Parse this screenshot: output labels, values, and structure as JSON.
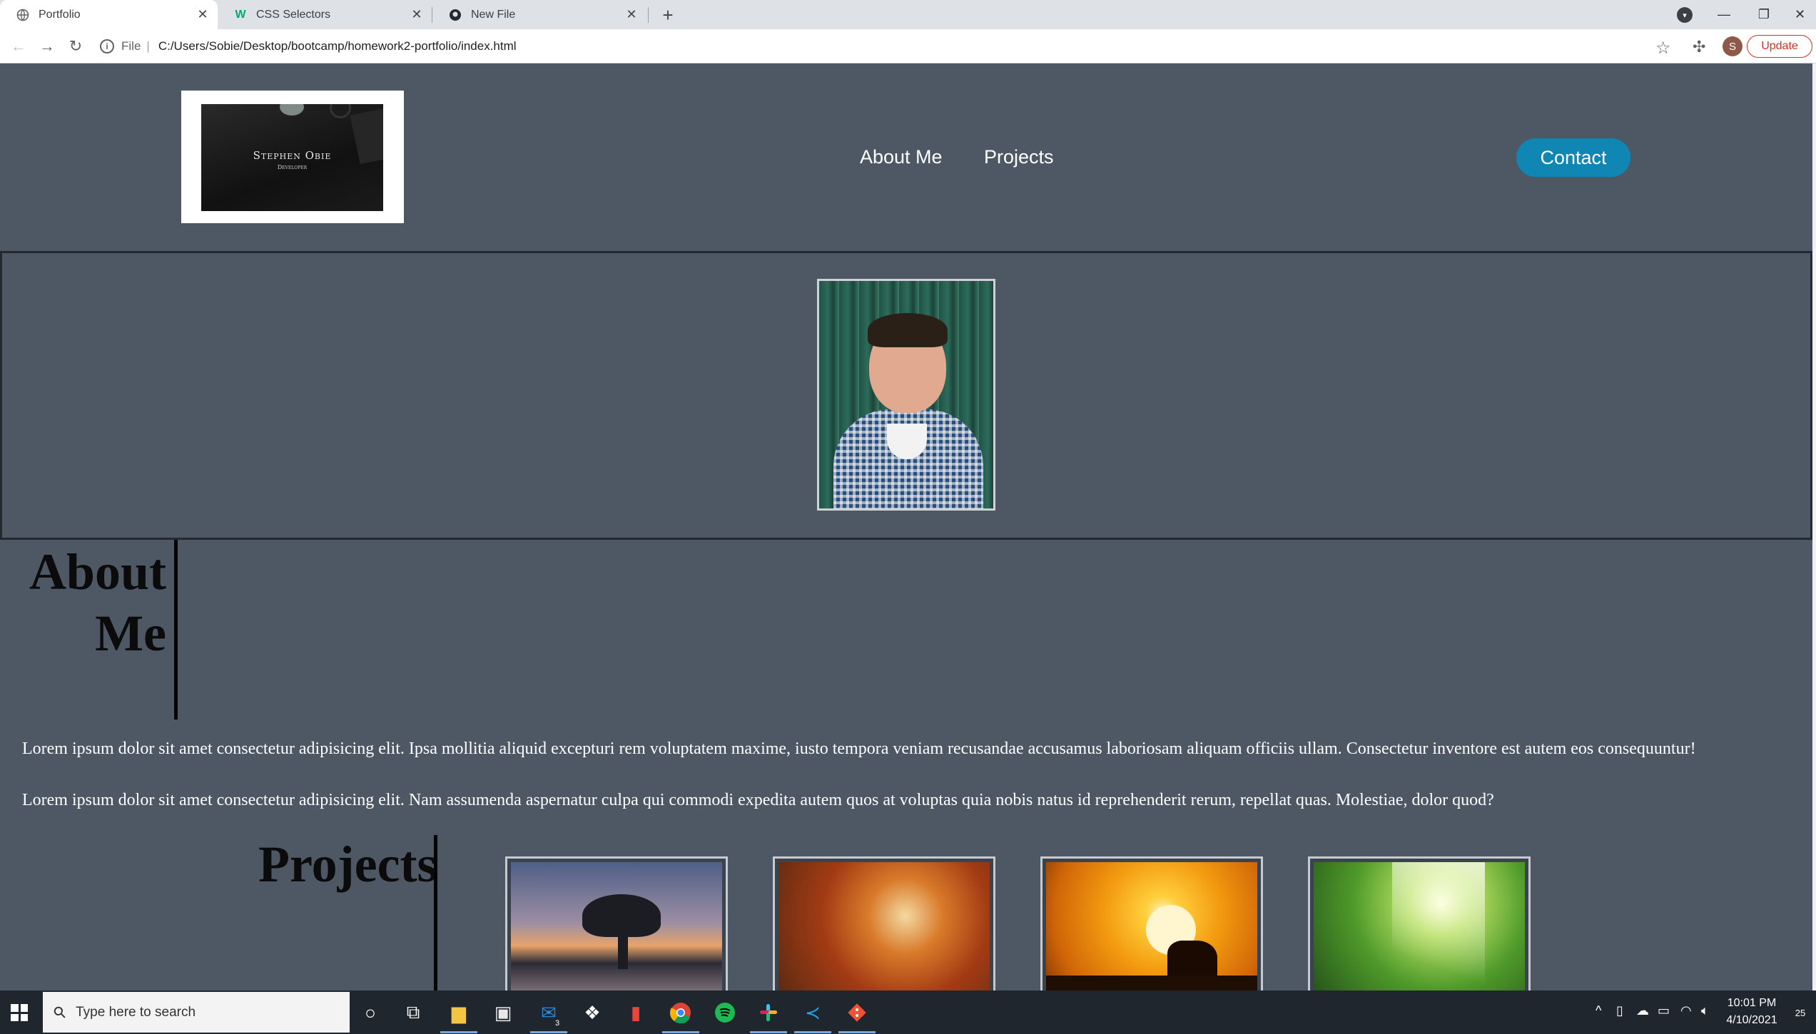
{
  "browser": {
    "tabs": [
      {
        "title": "Portfolio",
        "icon": "globe-icon"
      },
      {
        "title": "CSS Selectors",
        "icon": "w3schools-icon"
      },
      {
        "title": "New File",
        "icon": "github-icon"
      }
    ],
    "address": {
      "scheme": "File",
      "url": "C:/Users/Sobie/Desktop/bootcamp/homework2-portfolio/index.html"
    },
    "profile_initial": "S",
    "update_label": "Update"
  },
  "page": {
    "logo": {
      "name": "Stephen Obie",
      "role": "Developer"
    },
    "nav": [
      {
        "label": "About Me"
      },
      {
        "label": "Projects"
      }
    ],
    "contact_label": "Contact",
    "about": {
      "heading": "About Me",
      "paragraphs": [
        "Lorem ipsum dolor sit amet consectetur adipisicing elit. Ipsa mollitia aliquid excepturi rem voluptatem maxime, iusto tempora veniam recusandae accusamus laboriosam aliquam officiis ullam. Consectetur inventore est autem eos consequuntur!",
        "Lorem ipsum dolor sit amet consectetur adipisicing elit. Nam assumenda aspernatur culpa qui commodi expedita autem quos at voluptas quia nobis natus id reprehenderit rerum, repellat quas. Molestiae, dolor quod?"
      ]
    },
    "projects": {
      "heading": "Projects"
    }
  },
  "taskbar": {
    "search_placeholder": "Type here to search",
    "mail_badge": "3",
    "time": "10:01 PM",
    "date": "4/10/2021",
    "notification_count": "25"
  },
  "colors": {
    "page_background": "#4e5864",
    "contact_button": "#0f86b4",
    "update_accent": "#d93025"
  }
}
